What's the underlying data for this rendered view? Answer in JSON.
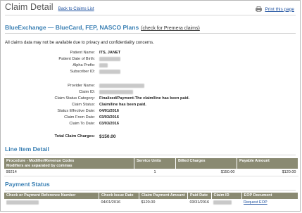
{
  "header": {
    "title": "Claim Detail",
    "back_link": "Back to Claims List",
    "print_link": "Print this page"
  },
  "plan": {
    "heading": "BlueExchange — BlueCard, FEP, NASCO Plans",
    "link": "(check for Premera claims)"
  },
  "privacy_note": "All claims data may not be available due to privacy and confidentiality concerns.",
  "patient": {
    "name_label": "Patient Name:",
    "name_value": "ITS, JANET",
    "dob_label": "Patient Date of Birth:",
    "alpha_label": "Alpha Prefix:",
    "subscriber_label": "Subscriber ID:"
  },
  "claim": {
    "provider_label": "Provider Name:",
    "claim_id_label": "Claim ID:",
    "category_label": "Claim Status Category:",
    "category_value": "Finalized/Payment-The claim/line has been paid.",
    "status_label": "Claim Status:",
    "status_value": "Claim/line has been paid.",
    "effective_label": "Status Effective Date:",
    "effective_value": "04/01/2016",
    "from_label": "Claim From Date:",
    "from_value": "03/03/2016",
    "to_label": "Claim To Date:",
    "to_value": "03/03/2016",
    "total_label": "Total Claim Charges:",
    "total_value": "$150.00"
  },
  "line_items": {
    "heading": "Line Item Detail",
    "columns": {
      "procedure": "Procedure - Modifier/Revenue Codes",
      "procedure_note": "Modifiers are separated by commas",
      "units": "Service Units",
      "billed": "Billed Charges",
      "payable": "Payable Amount"
    },
    "rows": [
      {
        "procedure": "99214",
        "units": "1",
        "billed": "$150.00",
        "payable": "$120.00"
      }
    ]
  },
  "payment": {
    "heading": "Payment Status",
    "columns": {
      "check_ref": "Check or Payment Reference Number",
      "issue_date": "Check Issue Date",
      "amount": "Claim Payment Amount",
      "paid_date": "Paid Date",
      "claim_id": "Claim ID",
      "eob": "EOP Document"
    },
    "rows": [
      {
        "issue_date": "04/01/2016",
        "amount": "$120.00",
        "paid_date": "03/31/2016",
        "eob": "Request EOP"
      }
    ]
  },
  "colors": {
    "heading_blue": "#3b80b4",
    "table_header": "#8a8a72",
    "link_blue": "#1a4e9e"
  }
}
